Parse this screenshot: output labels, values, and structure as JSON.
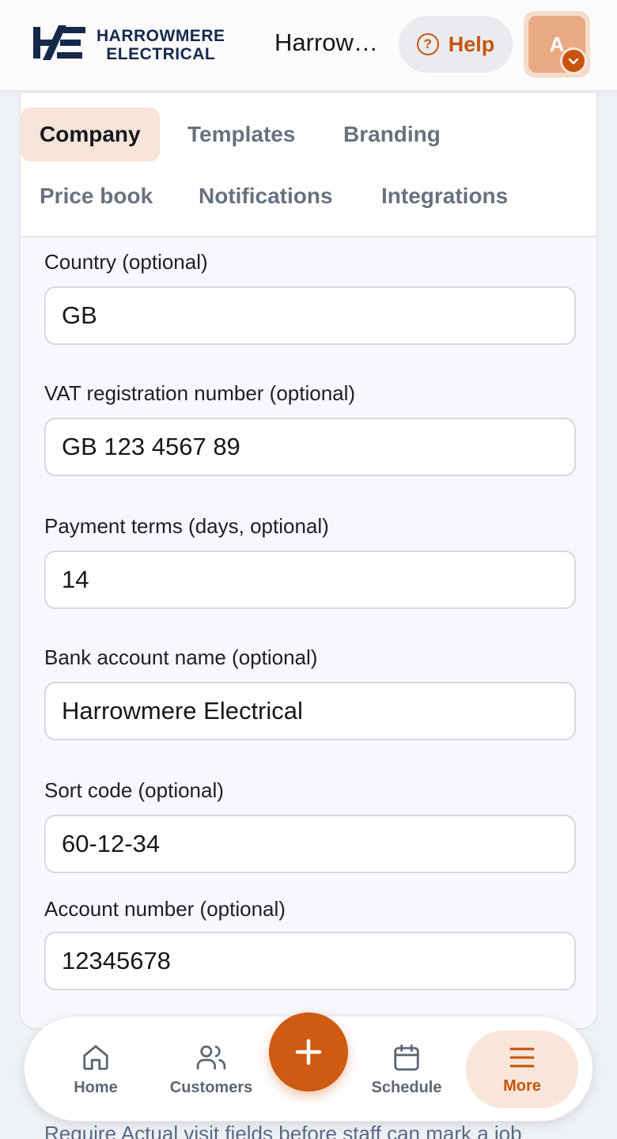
{
  "header": {
    "logo_line1": "HARROWMERE",
    "logo_line2": "ELECTRICAL",
    "company_name": "Harrowmere Electrical",
    "help_label": "Help",
    "avatar_initial": "A"
  },
  "tabs": [
    {
      "label": "Company",
      "active": true
    },
    {
      "label": "Templates",
      "active": false
    },
    {
      "label": "Branding",
      "active": false
    },
    {
      "label": "Price book",
      "active": false
    },
    {
      "label": "Notifications",
      "active": false
    },
    {
      "label": "Integrations",
      "active": false
    }
  ],
  "fields": [
    {
      "label": "Country (optional)",
      "value": "GB"
    },
    {
      "label": "VAT registration number (optional)",
      "value": "GB 123 4567 89"
    },
    {
      "label": "Payment terms (days, optional)",
      "value": "14"
    },
    {
      "label": "Bank account name (optional)",
      "value": "Harrowmere Electrical"
    },
    {
      "label": "Sort code (optional)",
      "value": "60-12-34"
    },
    {
      "label": "Account number (optional)",
      "value": "12345678"
    }
  ],
  "behind_text": "Require Actual visit fields before staff can mark a job",
  "bottom_nav": [
    {
      "label": "Home",
      "icon": "home-icon",
      "active": false
    },
    {
      "label": "Customers",
      "icon": "users-icon",
      "active": false
    },
    {
      "label": "Schedule",
      "icon": "calendar-icon",
      "active": false
    },
    {
      "label": "More",
      "icon": "menu-icon",
      "active": true
    }
  ],
  "colors": {
    "accent": "#c8540d",
    "accent_soft": "#f6e4d8",
    "brand_navy": "#16294b"
  }
}
